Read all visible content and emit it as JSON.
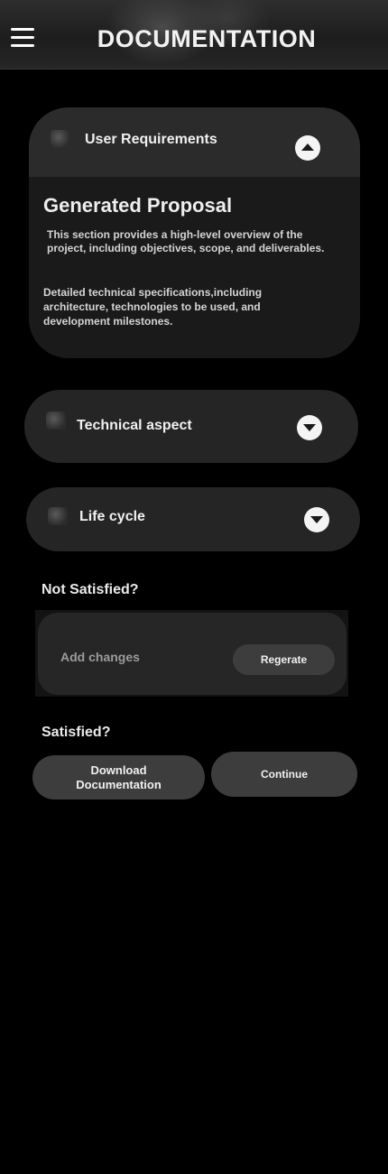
{
  "header": {
    "title": "DOCUMENTATION"
  },
  "sections": [
    {
      "title": "User Requirements",
      "expanded": true,
      "content_title": "Generated Proposal",
      "paragraphs": [
        "This section provides a high-level overview of the project, including objectives, scope, and deliverables.",
        "Detailed technical specifications,including architecture, technologies to be used, and development milestones."
      ]
    },
    {
      "title": "Technical aspect",
      "expanded": false
    },
    {
      "title": "Life cycle",
      "expanded": false
    }
  ],
  "not_satisfied": {
    "label": "Not Satisfied?",
    "input_placeholder": "Add changes",
    "button_label": "Regerate"
  },
  "satisfied": {
    "label": "Satisfied?",
    "download_label_line1": "Download",
    "download_label_line2": "Documentation",
    "continue_label": "Continue"
  },
  "icons": {
    "menu": "hamburger-menu-icon",
    "section_thumb": "section-thumbnail-icon",
    "expand": "chevron-down-icon",
    "collapse": "chevron-up-icon"
  },
  "colors": {
    "background": "#000000",
    "card": "#252525",
    "button": "#3d3d3d",
    "text": "#f0f0f0"
  }
}
